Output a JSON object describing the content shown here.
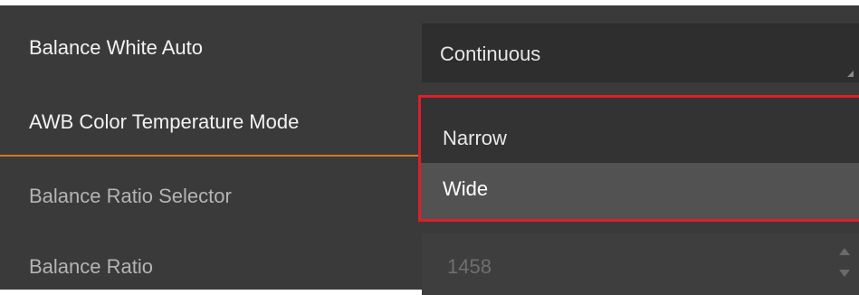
{
  "properties": [
    {
      "label": "Balance White Auto",
      "value": "Continuous",
      "control": "dropdown"
    },
    {
      "label": "AWB Color Temperature Mode",
      "control": "dropdown-open"
    },
    {
      "label": "Balance Ratio Selector",
      "control": "dropdown"
    },
    {
      "label": "Balance Ratio",
      "value": "1458",
      "control": "spinbox",
      "enabled": false
    }
  ],
  "dropdown": {
    "options": [
      "Narrow",
      "Wide"
    ],
    "hovered": "Wide"
  },
  "colors": {
    "panel_bg": "#3a3a3a",
    "highlight_border": "#e01d2a",
    "active_underline": "#d7761e",
    "hover_item": "#525252"
  }
}
